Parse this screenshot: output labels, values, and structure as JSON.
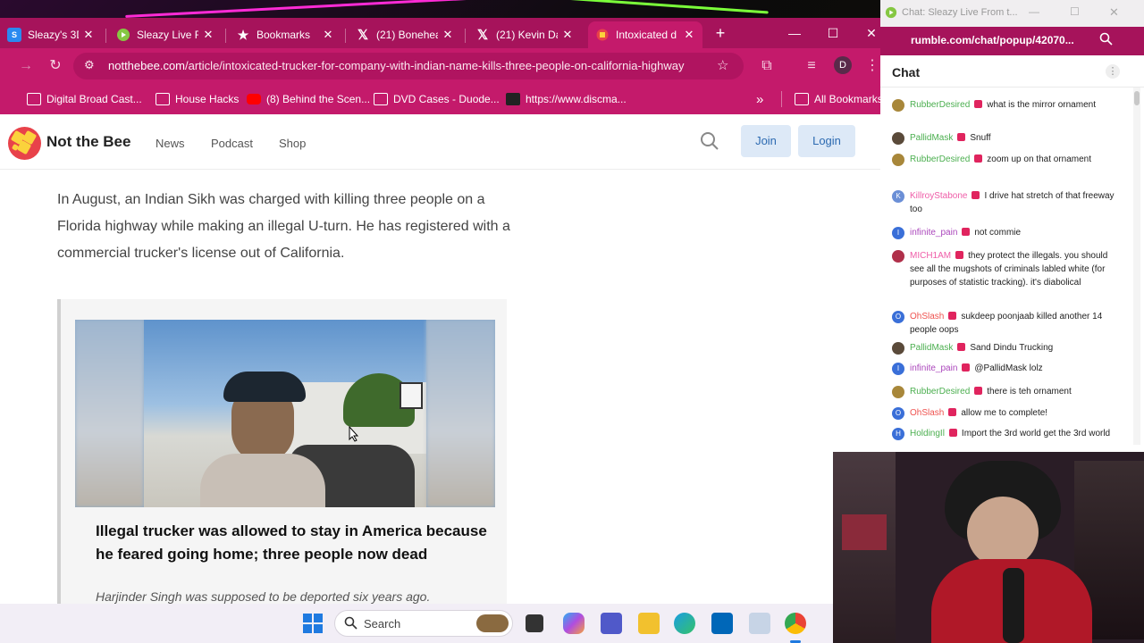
{
  "browser": {
    "tabs": [
      {
        "title": "Sleazy's 3D C",
        "icon": "site-icon",
        "active": false
      },
      {
        "title": "Sleazy Live Fr",
        "icon": "rumble-icon",
        "active": false
      },
      {
        "title": "Bookmarks",
        "icon": "star-icon",
        "active": false
      },
      {
        "title": "(21) Bonehea",
        "icon": "x-icon",
        "active": false
      },
      {
        "title": "(21) Kevin Da",
        "icon": "x-icon",
        "active": false
      },
      {
        "title": "Intoxicated d",
        "icon": "site-icon",
        "active": true
      }
    ],
    "new_tab": "+",
    "window_controls": {
      "minimize": "—",
      "maximize": "☐",
      "close": "✕"
    },
    "url_domain": "notthebee.com",
    "url_path": "/article/intoxicated-trucker-for-company-with-indian-name-kills-three-people-on-california-highway",
    "profile_initial": "D",
    "bookmarks": [
      {
        "label": "Digital Broad Cast...",
        "icon": "folder-icon"
      },
      {
        "label": "House Hacks",
        "icon": "folder-icon"
      },
      {
        "label": "(8) Behind the Scen...",
        "icon": "youtube-icon"
      },
      {
        "label": "DVD Cases - Duode...",
        "icon": "folder-icon"
      },
      {
        "label": "https://www.discma...",
        "icon": "site-icon"
      }
    ],
    "bookmarks_overflow": "»",
    "all_bookmarks": "All Bookmarks"
  },
  "site": {
    "name": "Not the Bee",
    "nav": [
      "News",
      "Podcast",
      "Shop"
    ],
    "join": "Join",
    "login": "Login"
  },
  "article": {
    "paragraph": "In August, an Indian Sikh was charged with killing three people on a Florida highway while making an illegal U-turn. He has registered with a commercial trucker's license out of California.",
    "card_title": "Illegal trucker was allowed to stay in America because he feared going home; three people now dead",
    "card_subtitle": "Harjinder Singh was supposed to be deported six years ago."
  },
  "chat": {
    "window_title": "Chat: Sleazy Live From t...",
    "url": "rumble.com/chat/popup/42070...",
    "header": "Chat",
    "messages": [
      {
        "user": "RubberDesired",
        "text": "what is the mirror ornament",
        "color": "#4caf50",
        "avatar": "#a8873a",
        "initial": ""
      },
      {
        "user": "PallidMask",
        "text": "Snuff",
        "color": "#4caf50",
        "avatar": "#5a4a3a",
        "initial": ""
      },
      {
        "user": "RubberDesired",
        "text": "zoom up on that ornament",
        "color": "#4caf50",
        "avatar": "#a8873a",
        "initial": ""
      },
      {
        "user": "KillroyStabone",
        "text": "I drive hat stretch of that freeway too",
        "color": "#ef5da8",
        "avatar": "#6b8fd6",
        "initial": "K"
      },
      {
        "user": "infinite_pain",
        "text": "not commie",
        "color": "#ab47bc",
        "avatar": "#3a6fd8",
        "initial": "I"
      },
      {
        "user": "MICH1AM",
        "text": "they protect the illegals. you should see all the mugshots of criminals labled white (for purposes of statistic tracking). it's diabolical",
        "color": "#ef5da8",
        "avatar": "#b0304a",
        "initial": ""
      },
      {
        "user": "OhSlash",
        "text": "sukdeep poonjaab killed another 14 people oops",
        "color": "#ef5350",
        "avatar": "#3a6fd8",
        "initial": "O"
      },
      {
        "user": "PallidMask",
        "text": "Sand Dindu Trucking",
        "color": "#4caf50",
        "avatar": "#5a4a3a",
        "initial": ""
      },
      {
        "user": "infinite_pain",
        "text": "@PallidMask lolz",
        "color": "#ab47bc",
        "avatar": "#3a6fd8",
        "initial": "I"
      },
      {
        "user": "RubberDesired",
        "text": "there is teh ornament",
        "color": "#4caf50",
        "avatar": "#a8873a",
        "initial": ""
      },
      {
        "user": "OhSlash",
        "text": "allow me to complete!",
        "color": "#ef5350",
        "avatar": "#3a6fd8",
        "initial": "O"
      },
      {
        "user": "HoldingIl",
        "text": "Import the 3rd world get the 3rd world",
        "color": "#4caf50",
        "avatar": "#3a6fd8",
        "initial": "H"
      }
    ]
  },
  "taskbar": {
    "search_placeholder": "Search"
  },
  "colors": {
    "accent": "#c41a6b",
    "tabstrip": "#a6135b",
    "button_bg": "#dde9f7",
    "button_text": "#2c6ab1"
  }
}
